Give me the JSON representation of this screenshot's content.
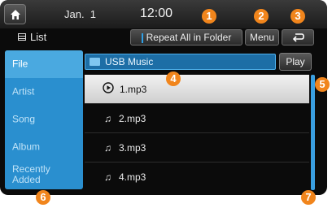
{
  "status": {
    "date": "Jan.  1",
    "time": "12:00"
  },
  "toolbar": {
    "list_label": "List",
    "repeat_label": "Repeat All in Folder",
    "menu_label": "Menu"
  },
  "categories": [
    {
      "label": "File"
    },
    {
      "label": "Artist"
    },
    {
      "label": "Song"
    },
    {
      "label": "Album"
    },
    {
      "label": "Recently Added"
    }
  ],
  "path": {
    "label": "USB Music"
  },
  "play_label": "Play",
  "files": [
    {
      "name": "1.mp3",
      "icon": "play-circle-icon"
    },
    {
      "name": "2.mp3",
      "icon": "music-note-icon"
    },
    {
      "name": "3.mp3",
      "icon": "music-note-icon"
    },
    {
      "name": "4.mp3",
      "icon": "music-note-icon"
    }
  ],
  "callouts": [
    "1",
    "2",
    "3",
    "4",
    "5",
    "6",
    "7"
  ],
  "colors": {
    "accent": "#2a8fcf",
    "callout": "#f1851c"
  }
}
